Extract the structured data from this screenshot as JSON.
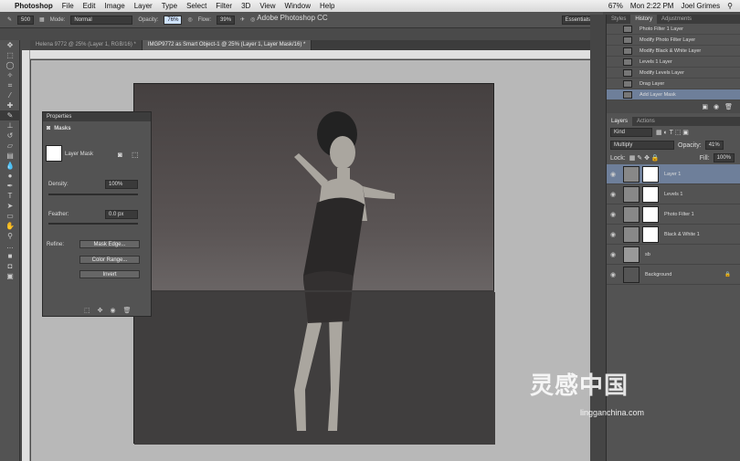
{
  "menubar": {
    "app": "Photoshop",
    "items": [
      "File",
      "Edit",
      "Image",
      "Layer",
      "Type",
      "Select",
      "Filter",
      "3D",
      "View",
      "Window",
      "Help"
    ],
    "clock": "Mon 2:22 PM",
    "user": "Joel Grimes",
    "battery": "67%"
  },
  "window_title": "Adobe Photoshop CC",
  "options": {
    "mode_label": "Mode:",
    "mode_value": "Normal",
    "opacity_label": "Opacity:",
    "opacity_value": "76%",
    "flow_label": "Flow:",
    "flow_value": "39%",
    "brush_size": "500",
    "workspace": "Essentials"
  },
  "doc_tabs": [
    {
      "label": "Helena 9772 @ 25% (Layer 1, RGB/16) *",
      "active": false
    },
    {
      "label": "IMGP9772 as Smart Object-1 @ 25% (Layer 1, Layer Mask/16) *",
      "active": true
    }
  ],
  "properties": {
    "title": "Properties",
    "section": "Masks",
    "mask_label": "Layer Mask",
    "density_label": "Density:",
    "density_value": "100%",
    "feather_label": "Feather:",
    "feather_value": "0.0 px",
    "refine_label": "Refine:",
    "btn_mask_edge": "Mask Edge...",
    "btn_color_range": "Color Range...",
    "btn_invert": "Invert"
  },
  "history": {
    "tabs": [
      "Styles",
      "History",
      "Adjustments"
    ],
    "items": [
      "Photo Filter 1 Layer",
      "Modify Photo Filter Layer",
      "Modify Black & White Layer",
      "Levels 1 Layer",
      "Modify Levels Layer",
      "Drag Layer",
      "Add Layer Mask"
    ]
  },
  "layers": {
    "tabs": [
      "Layers",
      "Actions"
    ],
    "kind": "Kind",
    "blend": "Multiply",
    "opacity_label": "Opacity:",
    "opacity_value": "41%",
    "fill_label": "Fill:",
    "fill_value": "100%",
    "lock_label": "Lock:",
    "rows": [
      "Layer 1",
      "Levels 1",
      "Photo Filter 1",
      "Black & White 1",
      "sb",
      "Background"
    ]
  },
  "watermark": {
    "text": "灵感中国",
    "url": "lingganchina.com"
  }
}
